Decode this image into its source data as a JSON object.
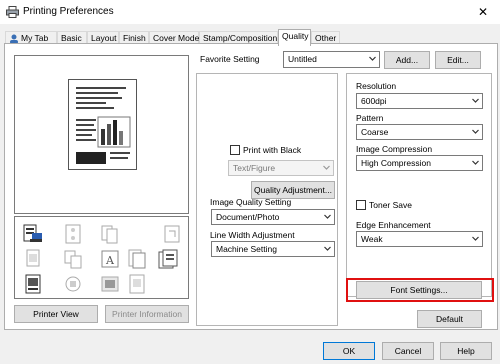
{
  "window": {
    "title": "Printing Preferences",
    "close_glyph": "✕"
  },
  "tabs": [
    {
      "label": "My Tab",
      "icon": "my-tab-icon"
    },
    {
      "label": "Basic"
    },
    {
      "label": "Layout"
    },
    {
      "label": "Finish"
    },
    {
      "label": "Cover Mode"
    },
    {
      "label": "Stamp/Composition"
    },
    {
      "label": "Quality",
      "active": true
    },
    {
      "label": "Other"
    }
  ],
  "left": {
    "printer_view_label": "Printer View",
    "printer_information_label": "Printer Information",
    "function_icons": [
      "staple-icon",
      "punch-icon",
      "fold-icon",
      "booklet-icon",
      "original-icon",
      "output-tray-icon",
      "sheet-icon",
      "book-icon",
      "text-icon",
      "image-icon",
      "cover-icon",
      "insert-icon",
      "watermark-icon"
    ]
  },
  "favorite": {
    "label": "Favorite Setting",
    "value": "Untitled",
    "add_label": "Add...",
    "edit_label": "Edit..."
  },
  "quality": {
    "print_with_black_label": "Print with Black",
    "print_with_black_checked": false,
    "text_figure_value": "Text/Figure",
    "quality_adjustment_label": "Quality Adjustment...",
    "image_quality_label": "Image Quality Setting",
    "image_quality_value": "Document/Photo",
    "line_width_label": "Line Width Adjustment",
    "line_width_value": "Machine Setting"
  },
  "right": {
    "resolution_label": "Resolution",
    "resolution_value": "600dpi",
    "pattern_label": "Pattern",
    "pattern_value": "Coarse",
    "image_compression_label": "Image Compression",
    "image_compression_value": "High Compression",
    "toner_save_label": "Toner Save",
    "toner_save_checked": false,
    "edge_enhancement_label": "Edge Enhancement",
    "edge_enhancement_value": "Weak",
    "font_settings_label": "Font Settings...",
    "default_label": "Default"
  },
  "footer": {
    "ok_label": "OK",
    "cancel_label": "Cancel",
    "help_label": "Help"
  },
  "colors": {
    "highlight": "#e01010",
    "selected_tab": "#ffffff",
    "face": "#f0f0f0"
  }
}
